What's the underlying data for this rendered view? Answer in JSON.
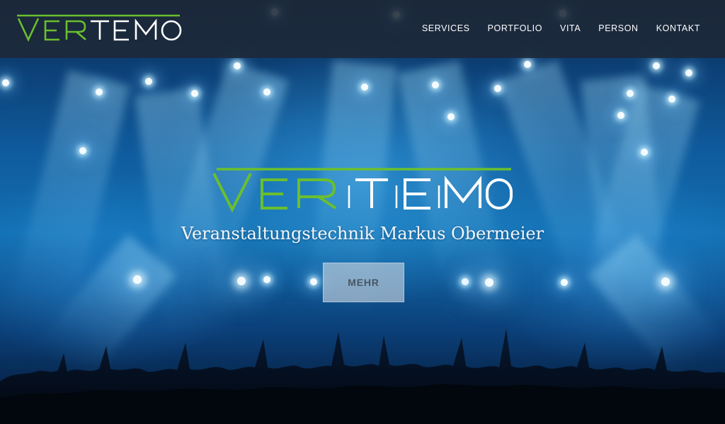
{
  "brand": {
    "logo_text_green": "VER",
    "logo_text_white": "TEMO",
    "colors": {
      "green": "#6abf2e",
      "white": "#ffffff",
      "header_bg": "#1e2837"
    }
  },
  "nav": {
    "items": [
      {
        "label": "SERVICES"
      },
      {
        "label": "PORTFOLIO"
      },
      {
        "label": "VITA"
      },
      {
        "label": "PERSON"
      },
      {
        "label": "KONTAKT"
      }
    ]
  },
  "hero": {
    "tagline": "Veranstaltungstechnik Markus Obermeier",
    "cta_label": "MEHR",
    "background": "concert-stage-photo"
  }
}
